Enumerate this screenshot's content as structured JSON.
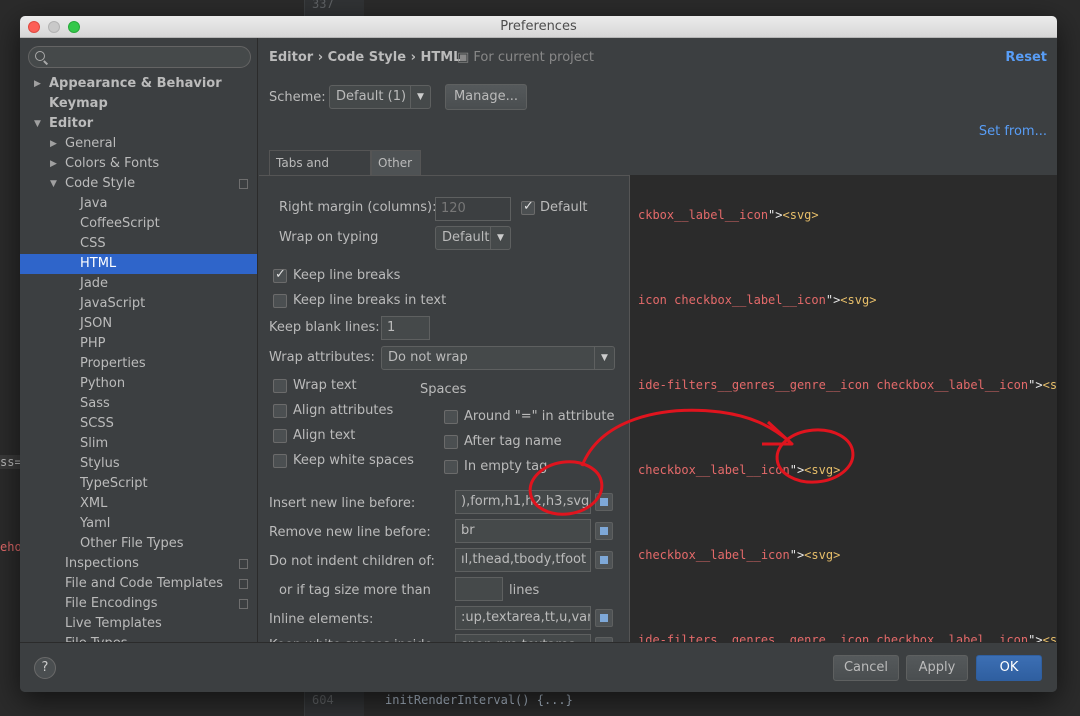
{
  "background": {
    "line_numbers": [
      "337",
      "604"
    ],
    "code_snippet": "initRenderInterval() {...}",
    "left_fragments": [
      "ss=",
      "eho"
    ]
  },
  "dialog": {
    "title": "Preferences"
  },
  "sidebar": {
    "search_placeholder": "",
    "items": [
      {
        "label": "Appearance & Behavior",
        "level": 0,
        "arrow": "right",
        "bold": true
      },
      {
        "label": "Keymap",
        "level": 0,
        "arrow": "",
        "bold": true
      },
      {
        "label": "Editor",
        "level": 0,
        "arrow": "down",
        "bold": true
      },
      {
        "label": "General",
        "level": 1,
        "arrow": "right"
      },
      {
        "label": "Colors & Fonts",
        "level": 1,
        "arrow": "right"
      },
      {
        "label": "Code Style",
        "level": 1,
        "arrow": "down",
        "project": true
      },
      {
        "label": "Java",
        "level": 2
      },
      {
        "label": "CoffeeScript",
        "level": 2
      },
      {
        "label": "CSS",
        "level": 2
      },
      {
        "label": "HTML",
        "level": 2,
        "selected": true
      },
      {
        "label": "Jade",
        "level": 2
      },
      {
        "label": "JavaScript",
        "level": 2
      },
      {
        "label": "JSON",
        "level": 2
      },
      {
        "label": "PHP",
        "level": 2
      },
      {
        "label": "Properties",
        "level": 2
      },
      {
        "label": "Python",
        "level": 2
      },
      {
        "label": "Sass",
        "level": 2
      },
      {
        "label": "SCSS",
        "level": 2
      },
      {
        "label": "Slim",
        "level": 2
      },
      {
        "label": "Stylus",
        "level": 2
      },
      {
        "label": "TypeScript",
        "level": 2
      },
      {
        "label": "XML",
        "level": 2
      },
      {
        "label": "Yaml",
        "level": 2
      },
      {
        "label": "Other File Types",
        "level": 2
      },
      {
        "label": "Inspections",
        "level": 1,
        "project": true
      },
      {
        "label": "File and Code Templates",
        "level": 1,
        "project": true
      },
      {
        "label": "File Encodings",
        "level": 1,
        "project": true
      },
      {
        "label": "Live Templates",
        "level": 1
      },
      {
        "label": "File Types",
        "level": 1
      }
    ]
  },
  "header": {
    "breadcrumb": "Editor › Code Style › HTML",
    "project_note": "For current project",
    "reset_label": "Reset",
    "scheme_label": "Scheme:",
    "scheme_value": "Default (1)",
    "manage_label": "Manage...",
    "set_from_label": "Set from..."
  },
  "tabs": [
    "Tabs and Indents",
    "Other"
  ],
  "options": {
    "right_margin_label": "Right margin (columns):",
    "right_margin_value": "120",
    "default_label": "Default",
    "default_checked": true,
    "wrap_typing_label": "Wrap on typing",
    "wrap_typing_value": "Default",
    "keep_line_breaks_label": "Keep line breaks",
    "keep_line_breaks_checked": true,
    "keep_line_breaks_text_label": "Keep line breaks in text",
    "keep_line_breaks_text_checked": false,
    "keep_blank_label": "Keep blank lines:",
    "keep_blank_value": "1",
    "wrap_attr_label": "Wrap attributes:",
    "wrap_attr_value": "Do not wrap",
    "wrap_text_label": "Wrap text",
    "align_attr_label": "Align attributes",
    "align_text_label": "Align text",
    "keep_ws_label": "Keep white spaces",
    "spaces_header": "Spaces",
    "around_eq_label": "Around \"=\" in attribute",
    "after_tag_label": "After tag name",
    "in_empty_label": "In empty tag",
    "insert_nl_label": "Insert new line before:",
    "insert_nl_value": "),form,h1,h2,h3,svg",
    "remove_nl_label": "Remove new line before:",
    "remove_nl_value": "br",
    "no_indent_label": "Do not indent children of:",
    "no_indent_value": "ıl,thead,tbody,tfoot",
    "tag_size_label": "or if tag size more than",
    "tag_size_value": "",
    "lines_label": "lines",
    "inline_label": "Inline elements:",
    "inline_value": ":up,textarea,tt,u,var",
    "keep_ws_inside_label": "Keep white spaces inside:",
    "keep_ws_inside_value": "span,pre,textarea"
  },
  "preview": {
    "lines": [
      {
        "str": "ckbox__label__icon",
        "q": "\">",
        "tag": "<svg>"
      },
      {
        "str": "icon checkbox__label__icon",
        "q": "\">",
        "tag": "<svg>"
      },
      {
        "str": "ide-filters__genres__genre__icon checkbox__label__icon",
        "q": "\">",
        "tag": "<svg>"
      },
      {
        "str": "checkbox__label__icon",
        "q": "\">",
        "tag": "<svg>"
      },
      {
        "str": "checkbox__label__icon",
        "q": "\">",
        "tag": "<svg>"
      },
      {
        "str": "ide-filters__genres__genre__icon checkbox__label__icon",
        "q": "\">",
        "tag": "<svg>"
      }
    ]
  },
  "footer": {
    "help_label": "?",
    "cancel_label": "Cancel",
    "apply_label": "Apply",
    "ok_label": "OK"
  },
  "colors": {
    "selection": "#2f65ca",
    "link": "#589df6",
    "annotation": "#e0141e"
  }
}
